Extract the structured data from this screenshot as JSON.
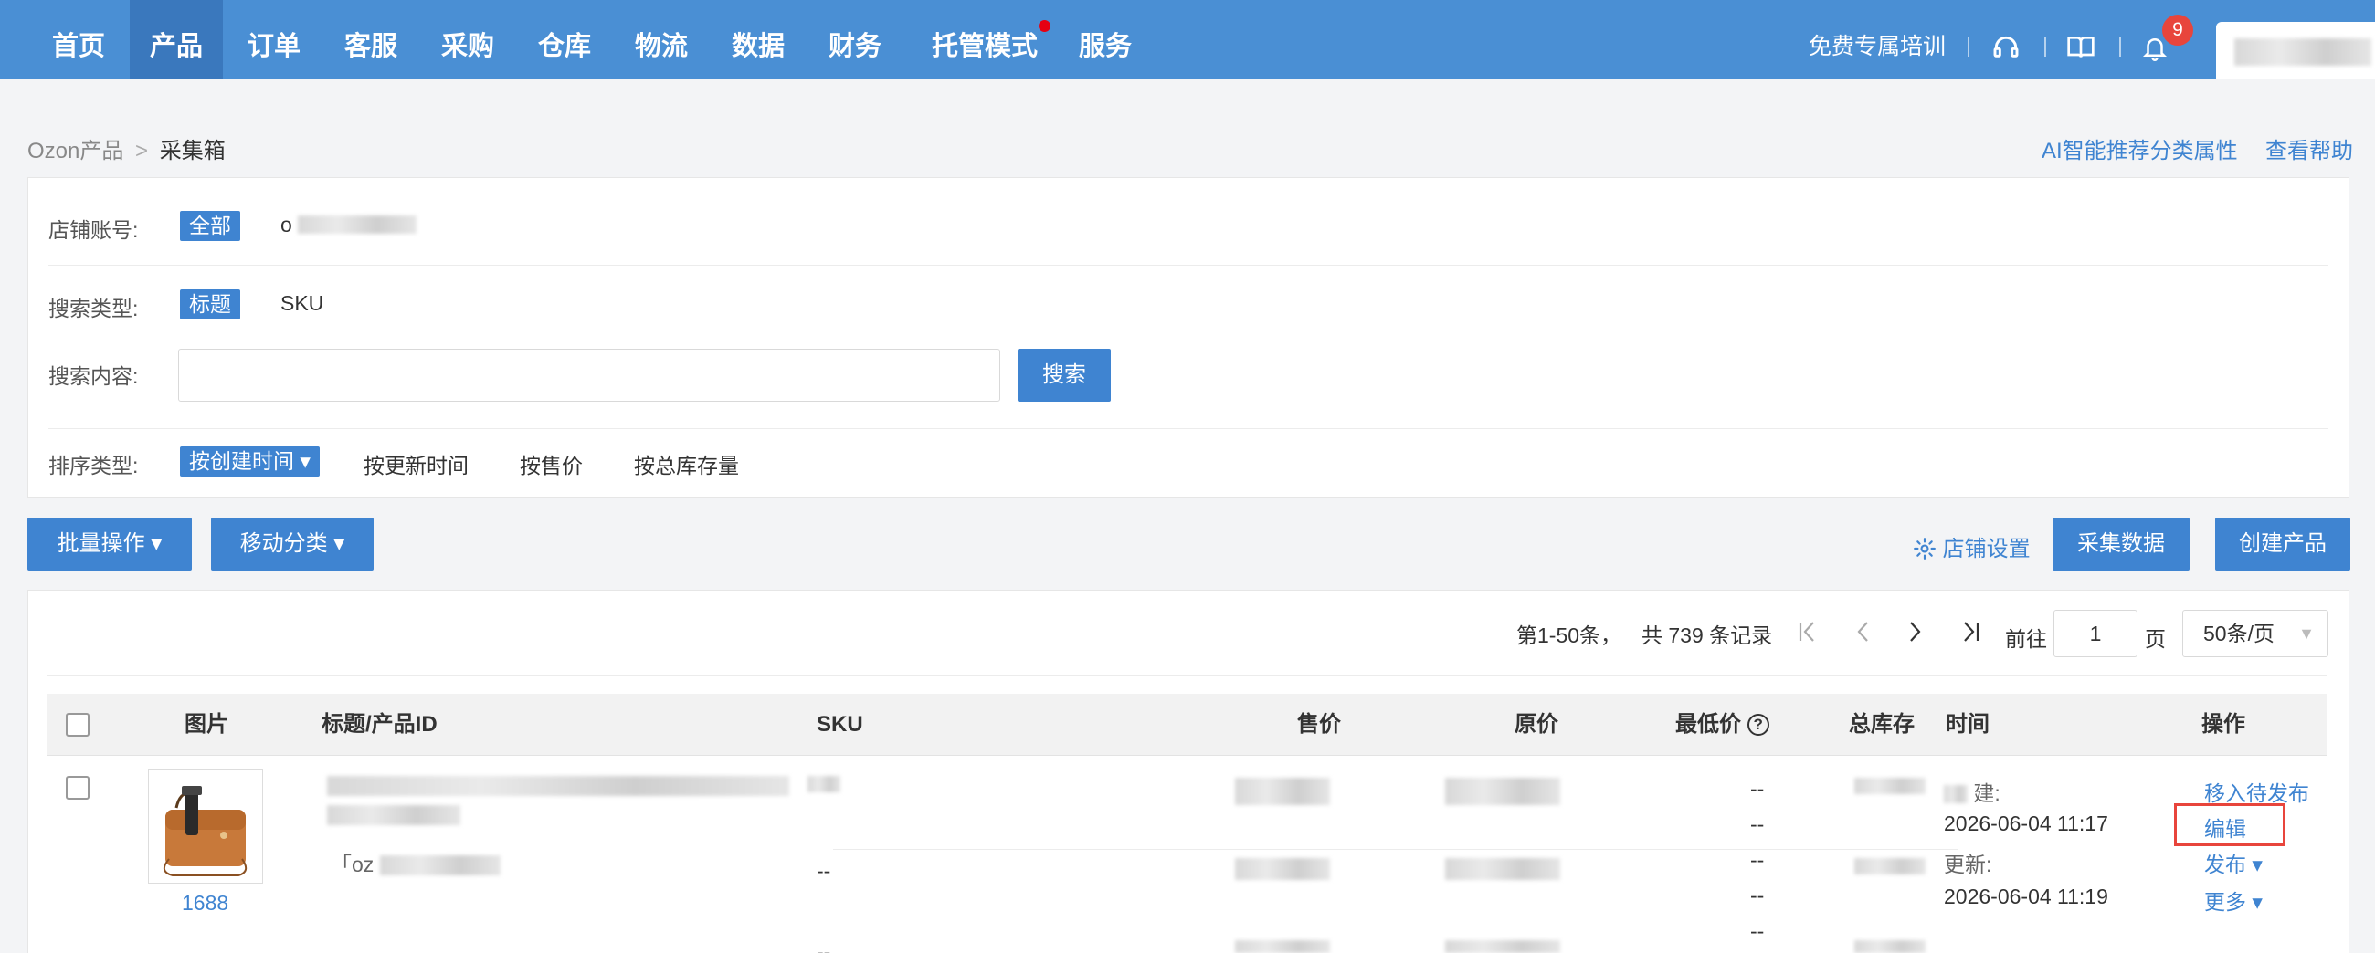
{
  "nav": {
    "items": [
      {
        "label": "首页",
        "active": false
      },
      {
        "label": "产品",
        "active": true
      },
      {
        "label": "订单",
        "active": false
      },
      {
        "label": "客服",
        "active": false
      },
      {
        "label": "采购",
        "active": false
      },
      {
        "label": "仓库",
        "active": false
      },
      {
        "label": "物流",
        "active": false
      },
      {
        "label": "数据",
        "active": false
      },
      {
        "label": "财务",
        "active": false
      },
      {
        "label": "托管模式",
        "active": false,
        "dot": true
      },
      {
        "label": "服务",
        "active": false
      }
    ],
    "training_link": "免费专属培训",
    "notification_count": "9",
    "colors": {
      "bar": "#4a8fd4",
      "active": "#3a78bd",
      "badge": "#e8453c"
    }
  },
  "breadcrumb": {
    "parent": "Ozon产品",
    "separator": ">",
    "current": "采集箱"
  },
  "top_links": {
    "ai": "AI智能推荐分类属性",
    "help": "查看帮助"
  },
  "filters": {
    "shop": {
      "label": "店铺账号:",
      "all": "全部",
      "account_prefix": "o"
    },
    "search_type": {
      "label": "搜索类型:",
      "selected": "标题",
      "other": "SKU"
    },
    "search_content": {
      "label": "搜索内容:",
      "placeholder": "",
      "button": "搜索"
    },
    "sort": {
      "label": "排序类型:",
      "selected": "按创建时间 ▾",
      "options": [
        "按更新时间",
        "按售价",
        "按总库存量"
      ]
    }
  },
  "actions": {
    "batch": "批量操作 ▾",
    "move": "移动分类 ▾",
    "shop_settings": "店铺设置",
    "collect": "采集数据",
    "create": "创建产品"
  },
  "pagination": {
    "range": "第1-50条，",
    "total": "共 739 条记录",
    "goto_label": "前往",
    "page": "1",
    "page_suffix": "页",
    "page_size": "50条/页"
  },
  "table": {
    "headers": {
      "image": "图片",
      "title": "标题/产品ID",
      "sku": "SKU",
      "price": "售价",
      "original": "原价",
      "lowest": "最低价",
      "stock": "总库存",
      "time": "时间",
      "ops": "操作"
    },
    "row": {
      "source": "1688",
      "id_prefix": "「oz",
      "sku_dash": "--",
      "sku_dash2": "--",
      "lowest": [
        "--",
        "--",
        "--",
        "--",
        "--"
      ],
      "created_label_tail": "建:",
      "created_time": "2026-06-04 11:17",
      "updated_label": "更新:",
      "updated_time": "2026-06-04 11:19",
      "ops": {
        "move": "移入待发布",
        "edit": "编辑",
        "publish": "发布 ▾",
        "more": "更多 ▾"
      }
    }
  }
}
